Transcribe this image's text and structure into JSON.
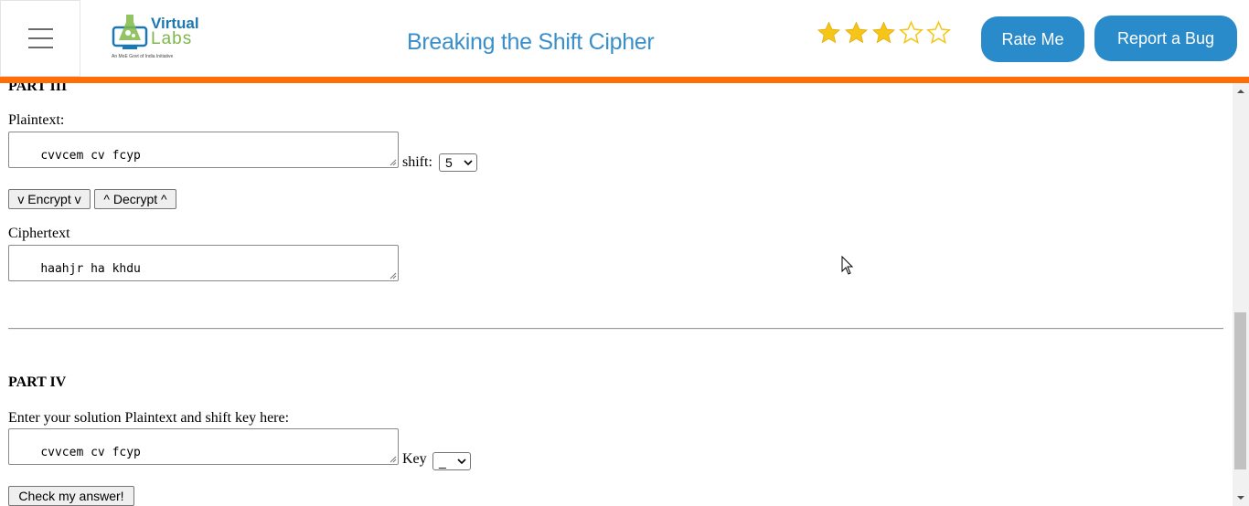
{
  "header": {
    "title": "Breaking the Shift Cipher",
    "logo": {
      "line1": "Virtual",
      "line2": "Labs",
      "tagline": "An MoE Govt of India Initiative"
    },
    "rating": {
      "filled": 3,
      "total": 5,
      "color": "#f5c518"
    },
    "rate_button": "Rate Me",
    "bug_button": "Report a Bug",
    "accent_color": "#ff6e06",
    "button_color": "#2a8bca"
  },
  "part3": {
    "heading": "PART III",
    "plaintext_label": "Plaintext:",
    "plaintext_value": "cvvcem cv fcyp",
    "shift_label": "shift:",
    "shift_value": "5",
    "encrypt_button": "v Encrypt v",
    "decrypt_button": "^ Decrypt ^",
    "ciphertext_label": "Ciphertext",
    "ciphertext_value": "haahjr ha khdu"
  },
  "part4": {
    "heading": "PART IV",
    "instruction": "Enter your solution Plaintext and shift key here:",
    "solution_value": "cvvcem cv fcyp",
    "key_label": "Key",
    "key_value": "_",
    "check_button": "Check my answer!"
  }
}
